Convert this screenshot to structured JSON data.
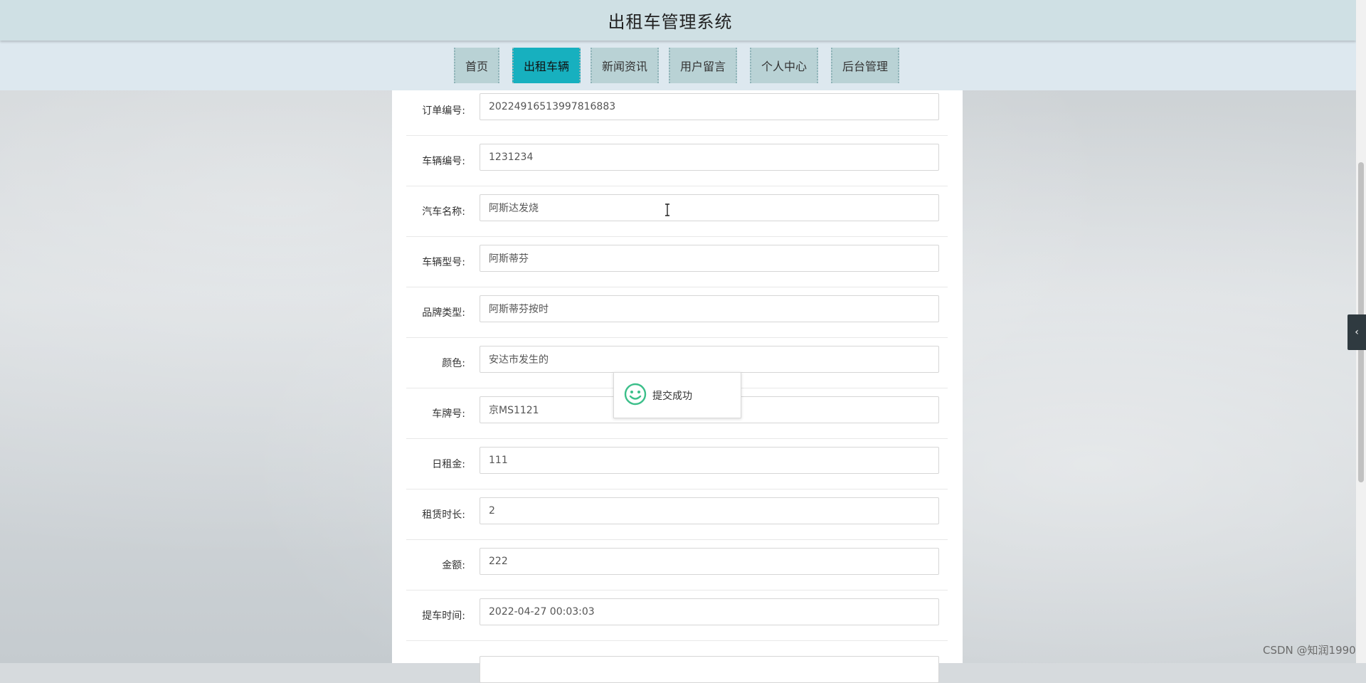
{
  "header": {
    "title": "出租车管理系统"
  },
  "nav": {
    "items": [
      {
        "label": "首页"
      },
      {
        "label": "出租车辆"
      },
      {
        "label": "新闻资讯"
      },
      {
        "label": "用户留言"
      },
      {
        "label": "个人中心"
      },
      {
        "label": "后台管理"
      }
    ],
    "active_index": 1
  },
  "form": {
    "fields": [
      {
        "label": "订单编号:",
        "value": "20224916513997816883"
      },
      {
        "label": "车辆编号:",
        "value": "1231234"
      },
      {
        "label": "汽车名称:",
        "value": "阿斯达发烧"
      },
      {
        "label": "车辆型号:",
        "value": "阿斯蒂芬"
      },
      {
        "label": "品牌类型:",
        "value": "阿斯蒂芬按时"
      },
      {
        "label": "颜色:",
        "value": "安达市发生的"
      },
      {
        "label": "车牌号:",
        "value": "京MS1121"
      },
      {
        "label": "日租金:",
        "value": "111"
      },
      {
        "label": "租赁时长:",
        "value": "2"
      },
      {
        "label": "金额:",
        "value": "222"
      },
      {
        "label": "提车时间:",
        "value": "2022-04-27 00:03:03"
      },
      {
        "label": "",
        "value": ""
      }
    ]
  },
  "toast": {
    "message": "提交成功",
    "icon": "smiley-icon"
  },
  "sidetab": {
    "icon": "chevron-left-icon",
    "glyph": "‹"
  },
  "watermark": {
    "text": "CSDN @知润1990"
  },
  "colors": {
    "active_tab": "#17b0bf",
    "tab": "#b9d2d5",
    "header": "#cfe0e4",
    "success": "#3cbf8a"
  }
}
